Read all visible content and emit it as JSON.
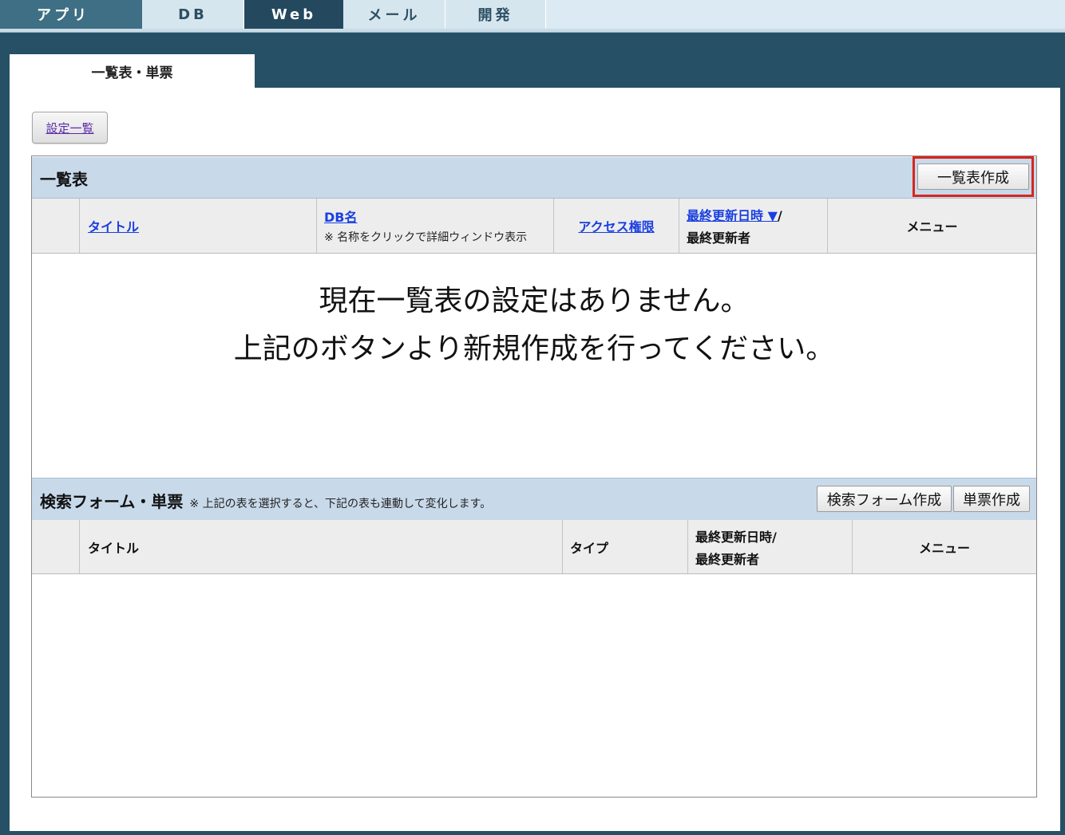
{
  "top_tabs": [
    "アプリ",
    "DB",
    "Web",
    "メール",
    "開発"
  ],
  "sub_tab": "一覧表・単票",
  "settings_button": "設定一覧",
  "list_section": {
    "title": "一覧表",
    "create_button": "一覧表作成",
    "columns": {
      "title": "タイトル",
      "db_name": "DB名",
      "db_note": "※ 名称をクリックで詳細ウィンドウ表示",
      "access": "アクセス権限",
      "updated_link": "最終更新日時 ▼",
      "updated_slash": "/",
      "updater": "最終更新者",
      "menu": "メニュー"
    },
    "empty_line1": "現在一覧表の設定はありません。",
    "empty_line2": "上記のボタンより新規作成を行ってください。"
  },
  "form_section": {
    "title": "検索フォーム・単票",
    "note": "※ 上記の表を選択すると、下記の表も連動して変化します。",
    "search_form_button": "検索フォーム作成",
    "single_form_button": "単票作成",
    "columns": {
      "title": "タイトル",
      "type": "タイプ",
      "updated": "最終更新日時/",
      "updater": "最終更新者",
      "menu": "メニュー"
    }
  },
  "colors": {
    "background": "#255066",
    "header_band": "#c8d9ea",
    "highlight": "#d9261c",
    "link": "#1a3fe0"
  }
}
